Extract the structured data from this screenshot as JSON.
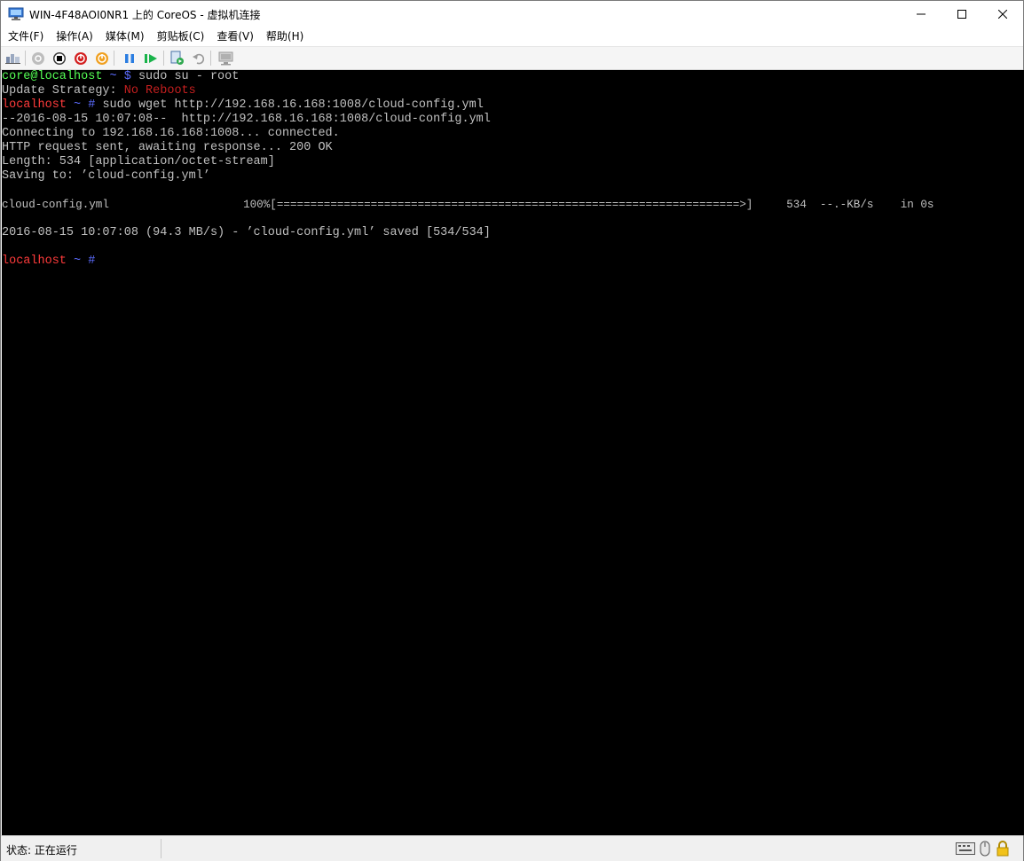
{
  "window": {
    "title": "WIN-4F48AOI0NR1 上的 CoreOS - 虚拟机连接",
    "minimize_glyph": "—",
    "maximize_glyph": "☐",
    "close_glyph": "✕"
  },
  "menu": {
    "items": [
      "文件(F)",
      "操作(A)",
      "媒体(M)",
      "剪贴板(C)",
      "查看(V)",
      "帮助(H)"
    ]
  },
  "toolbar": {
    "icons": [
      "ctrl-alt-del-icon",
      "start-icon",
      "turn-off-icon",
      "shutdown-icon",
      "save-icon",
      "pause-icon",
      "resume-icon",
      "checkpoint-icon",
      "revert-icon",
      "enhanced-session-icon"
    ]
  },
  "console": {
    "line1": {
      "user_host": "core@localhost",
      "tilde": " ~ ",
      "prompt": "$",
      "cmd": " sudo su - root"
    },
    "line2": {
      "label": "Update Strategy: ",
      "value": "No Reboots"
    },
    "line3": {
      "host": "localhost",
      "tilde": " ~ ",
      "prompt": "#",
      "cmd": " sudo wget http://192.168.16.168:1008/cloud-config.yml"
    },
    "line4": "--2016-08-15 10:07:08--  http://192.168.16.168:1008/cloud-config.yml",
    "line5": "Connecting to 192.168.16.168:1008... connected.",
    "line6": "HTTP request sent, awaiting response... 200 OK",
    "line7": "Length: 534 [application/octet-stream]",
    "line8": "Saving to: ’cloud-config.yml’",
    "line9": "cloud-config.yml                    100%[=====================================================================>]     534  --.-KB/s    in 0s",
    "line10": "2016-08-15 10:07:08 (94.3 MB/s) - ’cloud-config.yml’ saved [534/534]",
    "line11": {
      "host": "localhost",
      "tilde": " ~ ",
      "prompt": "#"
    }
  },
  "status": {
    "text": "状态: 正在运行",
    "icons": [
      "keyboard-icon",
      "mouse-icon",
      "lock-icon"
    ]
  },
  "colors": {
    "console_bg": "#000000",
    "prompt_green": "#55ff55",
    "prompt_red": "#ff3b3b",
    "warn_red": "#c51f1f",
    "prompt_blue": "#5c6cff"
  }
}
